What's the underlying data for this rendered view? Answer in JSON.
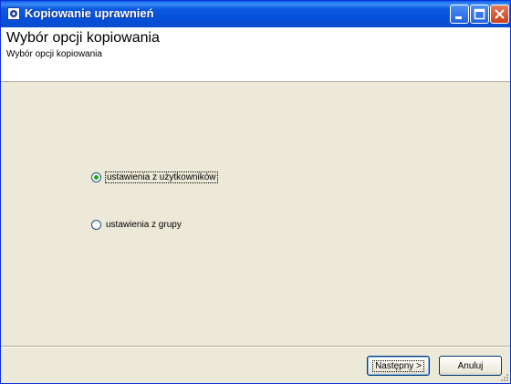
{
  "window": {
    "title": "Kopiowanie uprawnień"
  },
  "header": {
    "title": "Wybór opcji kopiowania",
    "subtitle": "Wybór opcji kopiowania"
  },
  "options": [
    {
      "label": "ustawienia z użytkowników",
      "selected": true
    },
    {
      "label": "ustawienia z grupy",
      "selected": false
    }
  ],
  "buttons": {
    "next": "Następny >",
    "cancel": "Anuluj"
  },
  "icons": [
    "app-icon",
    "minimize-icon",
    "maximize-icon",
    "close-icon",
    "size-grip-icon"
  ],
  "colors": {
    "titlebar": "#0550d8",
    "background": "#ece9d8",
    "radio_dot": "#21a121"
  }
}
